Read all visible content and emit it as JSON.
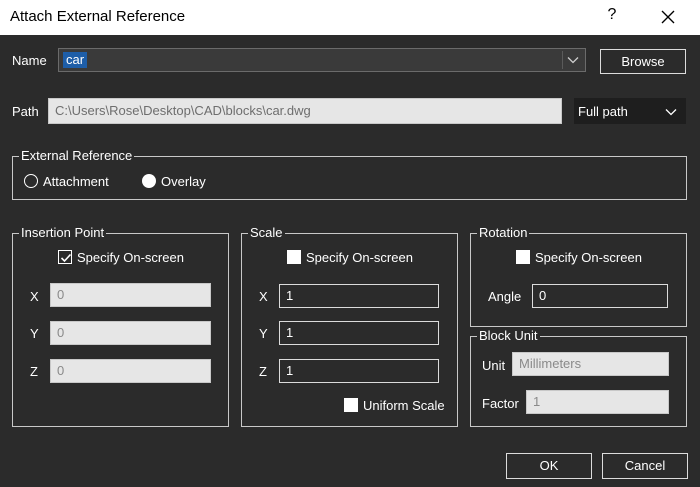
{
  "window": {
    "title": "Attach External Reference",
    "help_label": "?"
  },
  "name_row": {
    "label": "Name",
    "value": "car",
    "browse_label": "Browse"
  },
  "path_row": {
    "label": "Path",
    "value": "C:\\Users\\Rose\\Desktop\\CAD\\blocks\\car.dwg",
    "path_type": "Full path"
  },
  "external_reference": {
    "title": "External Reference",
    "attachment_label": "Attachment",
    "overlay_label": "Overlay",
    "selected": "Overlay"
  },
  "insertion_point": {
    "title": "Insertion Point",
    "specify_label": "Specify On-screen",
    "specify_checked": true,
    "x_label": "X",
    "x_value": "0",
    "y_label": "Y",
    "y_value": "0",
    "z_label": "Z",
    "z_value": "0"
  },
  "scale": {
    "title": "Scale",
    "specify_label": "Specify On-screen",
    "specify_checked": false,
    "x_label": "X",
    "x_value": "1",
    "y_label": "Y",
    "y_value": "1",
    "z_label": "Z",
    "z_value": "1",
    "uniform_label": "Uniform Scale",
    "uniform_checked": false
  },
  "rotation": {
    "title": "Rotation",
    "specify_label": "Specify On-screen",
    "specify_checked": false,
    "angle_label": "Angle",
    "angle_value": "0"
  },
  "block_unit": {
    "title": "Block Unit",
    "unit_label": "Unit",
    "unit_value": "Millimeters",
    "factor_label": "Factor",
    "factor_value": "1"
  },
  "footer": {
    "ok_label": "OK",
    "cancel_label": "Cancel"
  }
}
